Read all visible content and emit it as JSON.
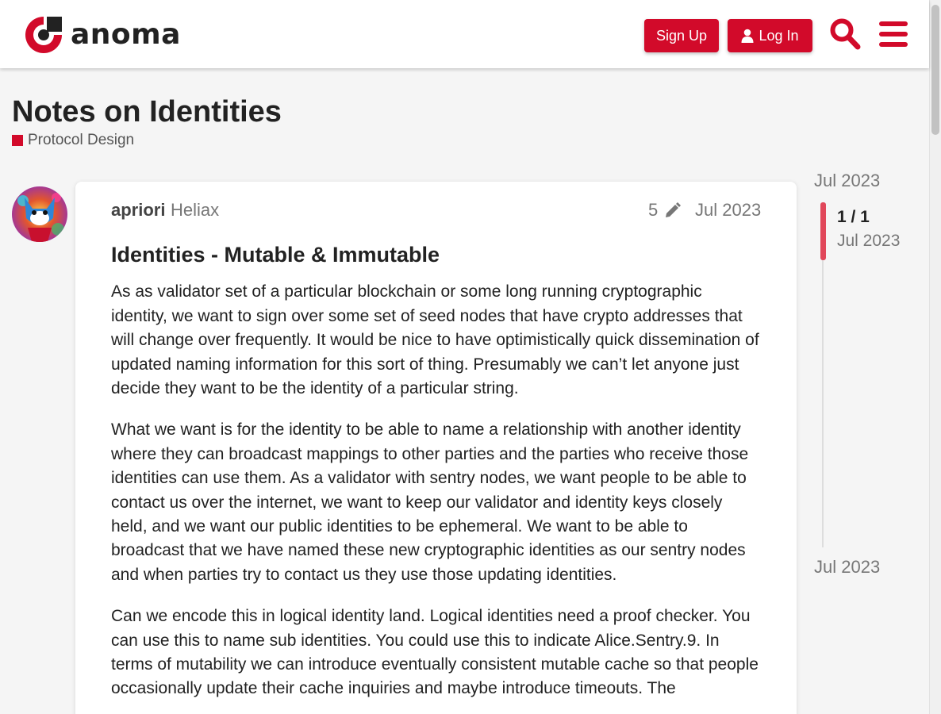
{
  "header": {
    "logo_text": "anoma",
    "signup_label": "Sign Up",
    "login_label": "Log In",
    "search_icon": "search-icon",
    "menu_icon": "hamburger-menu-icon"
  },
  "topic": {
    "title": "Notes on Identities",
    "category": "Protocol Design",
    "category_color": "#d20a2a"
  },
  "post": {
    "username": "apriori",
    "user_title": "Heliax",
    "edit_count": "5",
    "date": "Jul 2023",
    "heading": "Identities - Mutable & Immutable",
    "paragraphs": [
      "As as validator set of a particular blockchain or some long running cryptographic identity, we want to sign over some set of seed nodes that have crypto addresses that will change over frequently. It would be nice to have optimistically quick dissemination of updated naming information for this sort of thing. Presumably we can’t let anyone just decide they want to be the identity of a particular string.",
      "What we want is for the identity to be able to name a relationship with another identity where they can broadcast mappings to other parties and the parties who receive those identities can use them. As a validator with sentry nodes, we want people to be able to contact us over the internet, we want to keep our validator and identity keys closely held, and we want our public identities to be ephemeral. We want to be able to broadcast that we have named these new cryptographic identities as our sentry nodes and when parties try to contact us they use those updating identities.",
      "Can we encode this in logical identity land. Logical identities need a proof checker. You can use this to name sub identities. You could use this to indicate Alice.Sentry.9. In terms of mutability we can introduce eventually consistent mutable cache so that people occasionally update their cache inquiries and maybe introduce timeouts. The"
    ]
  },
  "timeline": {
    "top_date": "Jul 2023",
    "position": "1 / 1",
    "handle_date": "Jul 2023",
    "bottom_date": "Jul 2023"
  },
  "colors": {
    "accent": "#d20a2a",
    "timeline_handle": "#e1475a"
  }
}
